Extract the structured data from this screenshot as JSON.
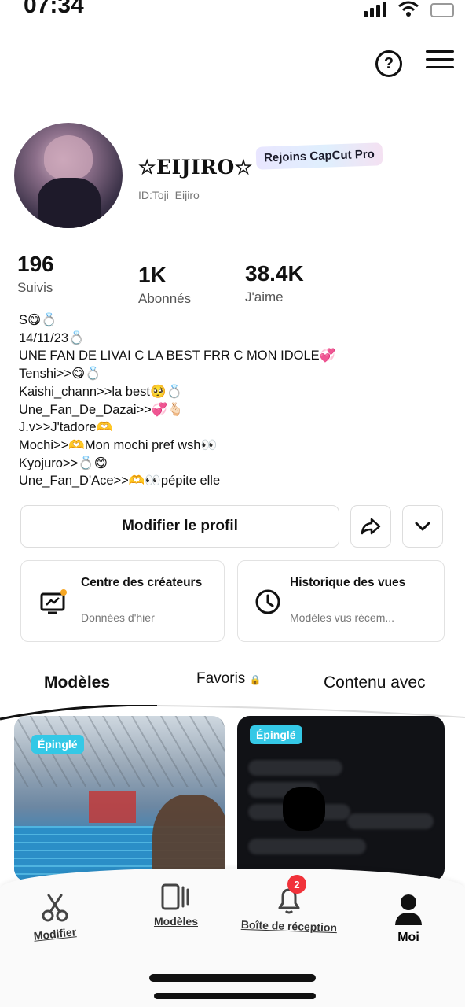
{
  "status_bar": {
    "time": "07:34"
  },
  "profile": {
    "display_name": "☆EIJIRO☆",
    "pro_badge": "Rejoins CapCut Pro",
    "user_id": "ID:Toji_Eijiro"
  },
  "stats": [
    {
      "value": "196",
      "label": "Suivis"
    },
    {
      "value": "1K",
      "label": "Abonnés"
    },
    {
      "value": "38.4K",
      "label": "J'aime"
    }
  ],
  "bio": [
    "S😋💍",
    "14/11/23💍",
    "UNE FAN DE LIVAI C LA BEST FRR C MON IDOLE💞",
    "Tenshi>>😋💍",
    "Kaishi_chann>>la best🥺💍",
    "Une_Fan_De_Dazai>>💞🫰🏻",
    "J.v>>J'tadore🫶",
    "Mochi>>🫶Mon mochi pref wsh👀",
    "Kyojuro>>💍😋",
    "Une_Fan_D'Ace>>🫶👀pépite elle"
  ],
  "actions": {
    "edit_profile": "Modifier le profil"
  },
  "cards": {
    "creator_center": {
      "title": "Centre des créateurs",
      "subtitle": "Données d'hier"
    },
    "view_history": {
      "title": "Historique des vues",
      "subtitle": "Modèles vus récem..."
    }
  },
  "tabs": {
    "templates": "Modèles",
    "favorites": "Favoris",
    "content_with": "Contenu avec"
  },
  "thumbnails": {
    "pinned_label": "Épinglé"
  },
  "bottom_nav": {
    "edit": "Modifier",
    "templates": "Modèles",
    "inbox": "Boîte de réception",
    "inbox_badge": "2",
    "me": "Moi"
  },
  "colors": {
    "pin": "#34c8e6",
    "badge": "#f1323a"
  }
}
